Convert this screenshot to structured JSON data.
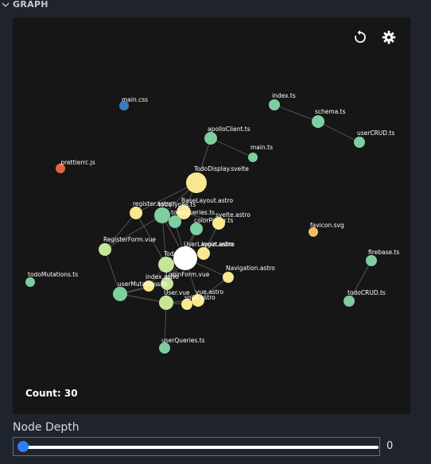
{
  "section": {
    "title": "GRAPH"
  },
  "toolbar": {
    "refresh_icon": "refresh-icon",
    "settings_icon": "gear-icon"
  },
  "graph": {
    "count_label": "Count: 30",
    "colors": {
      "green": "#7ecfa0",
      "yellow": "#f8e88f",
      "lime": "#c7e59a",
      "blue": "#3a7bbf",
      "orange": "#e4663c",
      "amber": "#f1bd62",
      "white": "#ffffff"
    },
    "nodes": [
      {
        "label": "main.css",
        "color": "blue"
      },
      {
        "label": "index.ts",
        "color": "green"
      },
      {
        "label": "schema.ts",
        "color": "green"
      },
      {
        "label": "userCRUD.ts",
        "color": "green"
      },
      {
        "label": "apolloClient.ts",
        "color": "green"
      },
      {
        "label": "main.ts",
        "color": "green"
      },
      {
        "label": ".prettierrc.js",
        "color": "orange"
      },
      {
        "label": "TodoDisplay.svelte",
        "color": "yellow"
      },
      {
        "label": "BaseLayout.astro",
        "color": "yellow"
      },
      {
        "label": "register.astro",
        "color": "yellow"
      },
      {
        "label": "todoTypes.ts",
        "color": "green"
      },
      {
        "label": "todoQueries.ts",
        "color": "green"
      },
      {
        "label": "colorPicker.ts",
        "color": "green"
      },
      {
        "label": "svelte.astro",
        "color": "yellow"
      },
      {
        "label": "favicon.svg",
        "color": "amber"
      },
      {
        "label": "RegisterForm.vue",
        "color": "lime"
      },
      {
        "label": "UserLayout.astro",
        "color": "white"
      },
      {
        "label": "login.astro",
        "color": "yellow"
      },
      {
        "label": "Todo",
        "color": "lime"
      },
      {
        "label": "firebase.ts",
        "color": "green"
      },
      {
        "label": "todoMutations.ts",
        "color": "green"
      },
      {
        "label": "Navigation.astro",
        "color": "yellow"
      },
      {
        "label": "LoginForm.vue",
        "color": "lime"
      },
      {
        "label": "index.astro",
        "color": "yellow"
      },
      {
        "label": "userMutations.ts",
        "color": "green"
      },
      {
        "label": "User.vue",
        "color": "lime"
      },
      {
        "label": "vue.astro",
        "color": "yellow"
      },
      {
        "label": "solid.astro",
        "color": "yellow"
      },
      {
        "label": "todoCRUD.ts",
        "color": "green"
      },
      {
        "label": "userQueries.ts",
        "color": "green"
      }
    ]
  },
  "node_depth": {
    "label": "Node Depth",
    "value": "0",
    "fraction": 0
  }
}
